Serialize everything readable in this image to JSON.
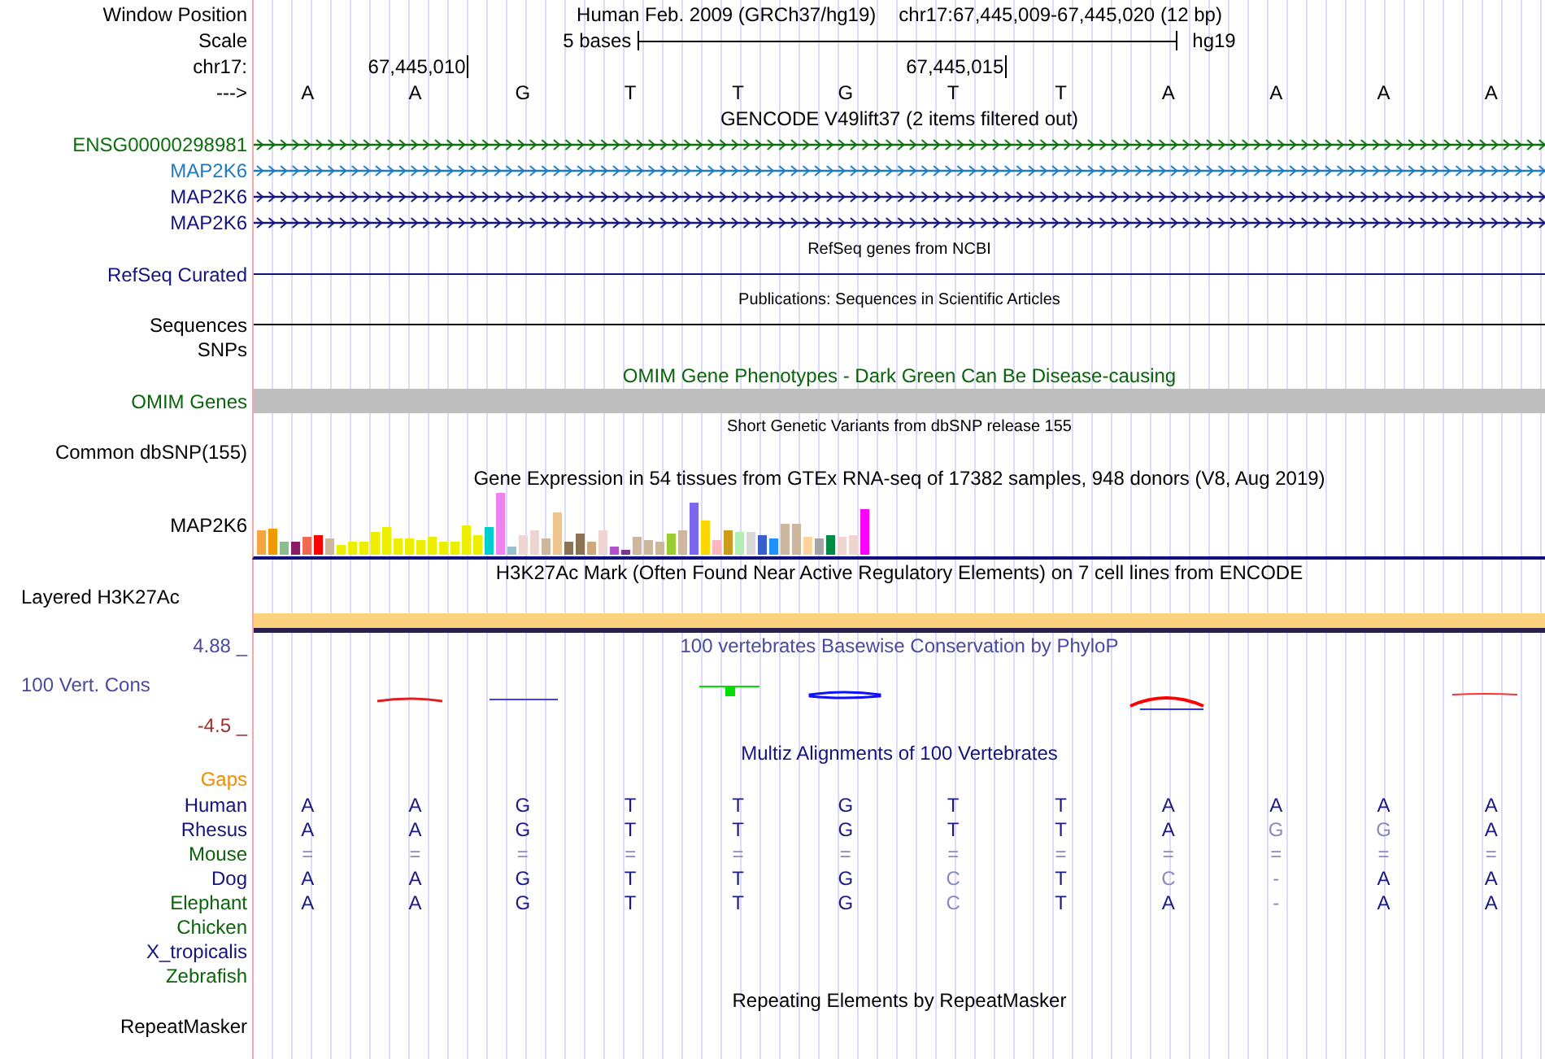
{
  "position_bar": {
    "label": "Window Position",
    "assembly": "Human Feb. 2009 (GRCh37/hg19)",
    "range": "chr17:67,445,009-67,445,020 (12 bp)"
  },
  "scale_bar": {
    "label": "Scale",
    "length": "5 bases",
    "database": "hg19"
  },
  "ruler": {
    "label": "chr17:",
    "strand": "--->",
    "bases": [
      {
        "base": "A"
      },
      {
        "base": "A",
        "coordinate": "67,445,010"
      },
      {
        "base": "G"
      },
      {
        "base": "T"
      },
      {
        "base": "T"
      },
      {
        "base": "G"
      },
      {
        "base": "T",
        "coordinate": "67,445,015"
      },
      {
        "base": "T"
      },
      {
        "base": "A"
      },
      {
        "base": "A"
      },
      {
        "base": "A"
      },
      {
        "base": "A"
      }
    ]
  },
  "tracks": [
    {
      "kind": "title",
      "text": "GENCODE V49lift37 (2 items filtered out)",
      "color": "#000000"
    },
    {
      "kind": "gene",
      "label": "ENSG00000298981",
      "color": "#0a6e0a"
    },
    {
      "kind": "gene",
      "label": "MAP2K6",
      "color": "#1f7ac0"
    },
    {
      "kind": "gene",
      "label": "MAP2K6",
      "color": "#14147c"
    },
    {
      "kind": "gene",
      "label": "MAP2K6",
      "color": "#14147c"
    },
    {
      "kind": "subtitle",
      "text": "RefSeq genes from NCBI",
      "color": "#000000"
    },
    {
      "kind": "line",
      "label": "RefSeq Curated",
      "color": "#14147c"
    },
    {
      "kind": "subtitle",
      "text": "Publications: Sequences in Scientific Articles",
      "color": "#000000"
    },
    {
      "kind": "line",
      "label": "Sequences",
      "color": "#000000"
    },
    {
      "kind": "label",
      "label": "SNPs",
      "color": "#000000"
    },
    {
      "kind": "title",
      "text": "OMIM Gene Phenotypes - Dark Green Can Be Disease-causing",
      "color": "#0a640a"
    },
    {
      "kind": "block",
      "label": "OMIM Genes",
      "color": "#0a640a"
    },
    {
      "kind": "subtitle",
      "text": "Short Genetic Variants from dbSNP release 155",
      "color": "#000000"
    },
    {
      "kind": "label",
      "label": "Common dbSNP(155)",
      "color": "#000000"
    },
    {
      "kind": "title",
      "text": "Gene Expression in 54 tissues from GTEx RNA-seq of 17382 samples, 948 donors (V8, Aug 2019)",
      "color": "#000000"
    },
    {
      "kind": "expression",
      "label": "MAP2K6",
      "color": "#000000"
    },
    {
      "kind": "title",
      "text": "H3K27Ac Mark (Often Found Near Active Regulatory Elements) on 7 cell lines from ENCODE",
      "color": "#000000"
    },
    {
      "kind": "signal",
      "label": "Layered H3K27Ac",
      "color": "#000000"
    },
    {
      "kind": "conservation",
      "label": "100 Vert. Cons",
      "color": "#4a4a9e",
      "max": "4.88 _",
      "min": "-4.5 _",
      "title": "100 vertebrates Basewise Conservation by PhyloP"
    },
    {
      "kind": "title",
      "text": "Multiz Alignments of 100 Vertebrates",
      "color": "#14147c"
    },
    {
      "kind": "label",
      "label": "Gaps",
      "color": "#f08c00"
    },
    {
      "kind": "alignment",
      "label": "Human",
      "color": "#14147c",
      "bases": [
        {
          "base": "A",
          "dim": false
        },
        {
          "base": "A",
          "dim": false
        },
        {
          "base": "G",
          "dim": false
        },
        {
          "base": "T",
          "dim": false
        },
        {
          "base": "T",
          "dim": false
        },
        {
          "base": "G",
          "dim": false
        },
        {
          "base": "T",
          "dim": false
        },
        {
          "base": "T",
          "dim": false
        },
        {
          "base": "A",
          "dim": false
        },
        {
          "base": "A",
          "dim": false
        },
        {
          "base": "A",
          "dim": false
        },
        {
          "base": "A",
          "dim": false
        }
      ]
    },
    {
      "kind": "alignment",
      "label": "Rhesus",
      "color": "#14147c",
      "bases": [
        {
          "base": "A",
          "dim": false
        },
        {
          "base": "A",
          "dim": false
        },
        {
          "base": "G",
          "dim": false
        },
        {
          "base": "T",
          "dim": false
        },
        {
          "base": "T",
          "dim": false
        },
        {
          "base": "G",
          "dim": false
        },
        {
          "base": "T",
          "dim": false
        },
        {
          "base": "T",
          "dim": false
        },
        {
          "base": "A",
          "dim": false
        },
        {
          "base": "G",
          "dim": true
        },
        {
          "base": "G",
          "dim": true
        },
        {
          "base": "A",
          "dim": false
        }
      ]
    },
    {
      "kind": "alignment",
      "label": "Mouse",
      "color": "#0a640a",
      "bases": [
        {
          "base": "=",
          "dim": true
        },
        {
          "base": "=",
          "dim": true
        },
        {
          "base": "=",
          "dim": true
        },
        {
          "base": "=",
          "dim": true
        },
        {
          "base": "=",
          "dim": true
        },
        {
          "base": "=",
          "dim": true
        },
        {
          "base": "=",
          "dim": true
        },
        {
          "base": "=",
          "dim": true
        },
        {
          "base": "=",
          "dim": true
        },
        {
          "base": "=",
          "dim": true
        },
        {
          "base": "=",
          "dim": true
        },
        {
          "base": "=",
          "dim": true
        }
      ]
    },
    {
      "kind": "alignment",
      "label": "Dog",
      "color": "#14147c",
      "bases": [
        {
          "base": "A",
          "dim": false
        },
        {
          "base": "A",
          "dim": false
        },
        {
          "base": "G",
          "dim": false
        },
        {
          "base": "T",
          "dim": false
        },
        {
          "base": "T",
          "dim": false
        },
        {
          "base": "G",
          "dim": false
        },
        {
          "base": "C",
          "dim": true
        },
        {
          "base": "T",
          "dim": false
        },
        {
          "base": "C",
          "dim": true
        },
        {
          "base": "-",
          "dim": true
        },
        {
          "base": "A",
          "dim": false
        },
        {
          "base": "A",
          "dim": false
        }
      ]
    },
    {
      "kind": "alignment",
      "label": "Elephant",
      "color": "#0a640a",
      "bases": [
        {
          "base": "A",
          "dim": false
        },
        {
          "base": "A",
          "dim": false
        },
        {
          "base": "G",
          "dim": false
        },
        {
          "base": "T",
          "dim": false
        },
        {
          "base": "T",
          "dim": false
        },
        {
          "base": "G",
          "dim": false
        },
        {
          "base": "C",
          "dim": true
        },
        {
          "base": "T",
          "dim": false
        },
        {
          "base": "A",
          "dim": false
        },
        {
          "base": "-",
          "dim": true
        },
        {
          "base": "A",
          "dim": false
        },
        {
          "base": "A",
          "dim": false
        }
      ]
    },
    {
      "kind": "alignment",
      "label": "Chicken",
      "color": "#0a640a"
    },
    {
      "kind": "alignment",
      "label": "X_tropicalis",
      "color": "#14147c"
    },
    {
      "kind": "alignment",
      "label": "Zebrafish",
      "color": "#0a640a"
    },
    {
      "kind": "title",
      "text": "Repeating Elements by RepeatMasker",
      "color": "#000000"
    },
    {
      "kind": "label",
      "label": "RepeatMasker",
      "color": "#000000"
    }
  ]
}
